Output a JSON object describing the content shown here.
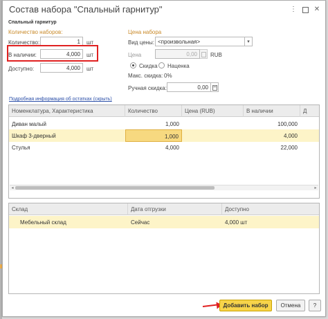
{
  "window": {
    "title": "Состав набора \"Спальный гарнитур\"",
    "section_name": "Спальный гарнитур",
    "more_icon": "more-vertical-icon",
    "maximize_icon": "maximize-icon",
    "close_icon": "close-icon"
  },
  "quantity_group": {
    "label": "Количество наборов:",
    "quantity_label": "Количество:",
    "quantity_value": "1",
    "quantity_unit": "шт",
    "in_stock_label": "В наличии:",
    "in_stock_value": "4,000",
    "in_stock_unit": "шт",
    "available_label": "Доступно:",
    "available_value": "4,000",
    "available_unit": "шт"
  },
  "price_group": {
    "label": "Цена набора",
    "price_type_label": "Вид цены:",
    "price_type_value": "<произвольная>",
    "price_label": "Цена",
    "price_value": "0,00",
    "currency": "RUB",
    "discount_option": "Скидка",
    "markup_option": "Наценка",
    "max_discount_label": "Макс. скидка:",
    "max_discount_value": "0%",
    "manual_discount_label": "Ручная скидка:",
    "manual_discount_value": "0,00"
  },
  "details_link": "Подробная информация об остатках (скрыть)",
  "items_table": {
    "columns": [
      "Номенклатура, Характеристика",
      "Количество",
      "Цена (RUB)",
      "В наличии",
      "Д"
    ],
    "rows": [
      [
        "Диван малый",
        "1,000",
        "",
        "100,000"
      ],
      [
        "Шкаф 3-дверный",
        "1,000",
        "",
        "4,000"
      ],
      [
        "Стулья",
        "4,000",
        "",
        "22,000"
      ]
    ]
  },
  "stock_table": {
    "columns": [
      "Склад",
      "Дата отгрузки",
      "Доступно"
    ],
    "rows": [
      [
        "Мебельный склад",
        "Сейчас",
        "4,000 шт"
      ]
    ]
  },
  "footer": {
    "add_button": "Добавить набор",
    "cancel_button": "Отмена",
    "help_button": "?"
  },
  "colors": {
    "accent_yellow": "#f7d44a",
    "highlight_red": "#e02020",
    "group_label_orange": "#c98a2a",
    "selected_row": "#fdf4c8"
  }
}
